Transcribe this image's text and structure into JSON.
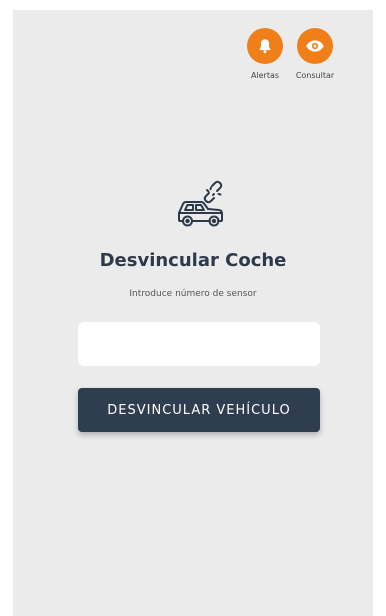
{
  "header": {
    "actions": [
      {
        "label": "Alertas",
        "icon": "bell-icon",
        "color": "#f07f1a"
      },
      {
        "label": "Consultar",
        "icon": "eye-icon",
        "color": "#f07f1a"
      }
    ]
  },
  "main": {
    "hero_icon": "car-unlink-icon",
    "title": "Desvincular Coche",
    "subtitle": "Introduce número de sensor",
    "sensor_input": {
      "value": "",
      "placeholder": ""
    },
    "button_label": "DESVINCULAR VEHÍCULO"
  },
  "colors": {
    "accent": "#f07f1a",
    "primary_button": "#2f3d50",
    "background": "#ebebeb"
  }
}
